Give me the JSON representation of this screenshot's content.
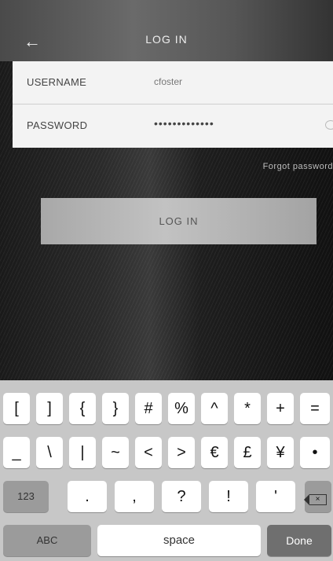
{
  "header": {
    "back_icon": "arrow-left-icon",
    "title": "LOG IN"
  },
  "form": {
    "username_label": "USERNAME",
    "username_value": "cfoster",
    "password_label": "PASSWORD",
    "password_value": "•••••••••••••",
    "visibility_icon": "eye-icon"
  },
  "forgot_password": "Forgot password",
  "login_button": "LOG IN",
  "keyboard": {
    "row1": [
      "[",
      "]",
      "{",
      "}",
      "#",
      "%",
      "^",
      "*",
      "+",
      "="
    ],
    "row2": [
      "_",
      "\\",
      "|",
      "~",
      "<",
      ">",
      "€",
      "£",
      "¥",
      "•"
    ],
    "mode_key": "123",
    "row3": [
      ".",
      ",",
      "?",
      "!",
      "'"
    ],
    "backspace_icon": "backspace-icon",
    "abc_key": "ABC",
    "space_key": "space",
    "done_key": "Done"
  }
}
